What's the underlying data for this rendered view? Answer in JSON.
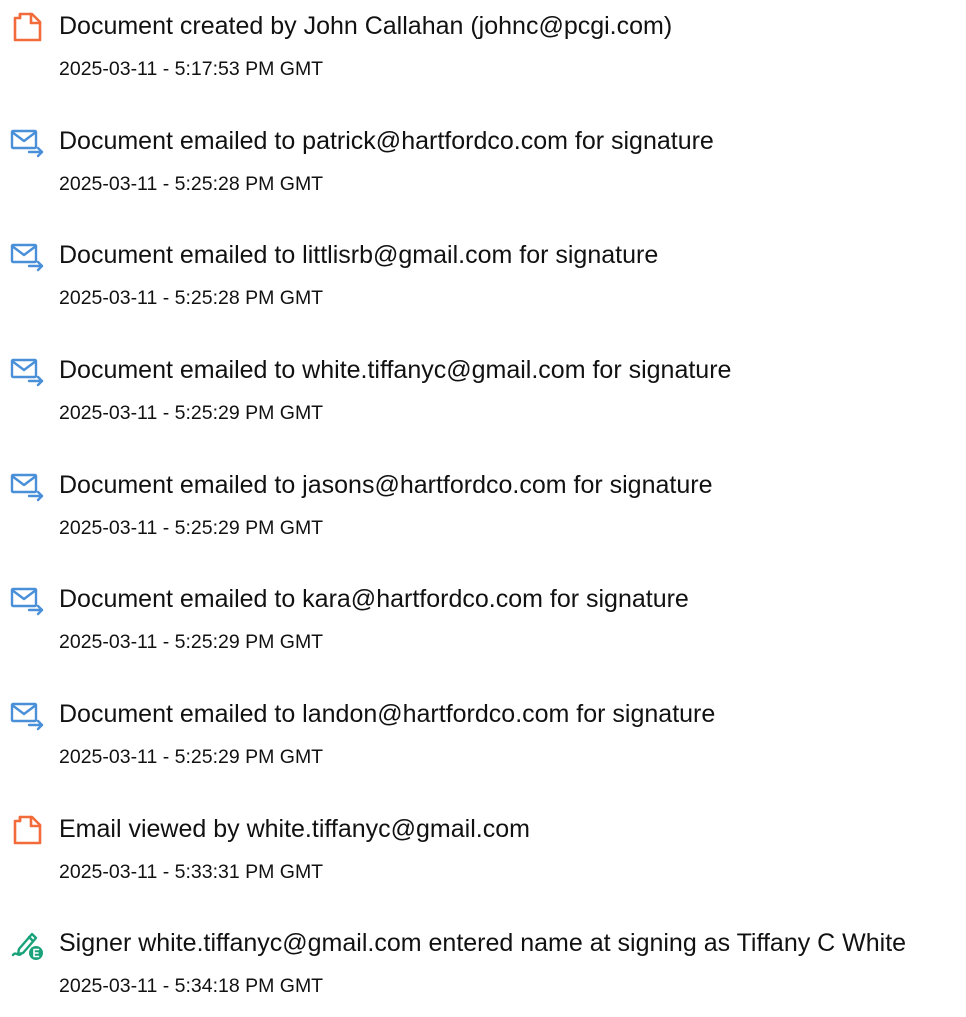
{
  "icon_colors": {
    "document": "#f26b3a",
    "email": "#4a90d9",
    "signature": "#1aa37a"
  },
  "events": [
    {
      "icon": "document-icon",
      "description": "Document created by John Callahan (johnc@pcgi.com)",
      "timestamp": "2025-03-11 - 5:17:53 PM GMT"
    },
    {
      "icon": "email-sent-icon",
      "description": "Document emailed to patrick@hartfordco.com for signature",
      "timestamp": "2025-03-11 - 5:25:28 PM GMT"
    },
    {
      "icon": "email-sent-icon",
      "description": "Document emailed to littlisrb@gmail.com for signature",
      "timestamp": "2025-03-11 - 5:25:28 PM GMT"
    },
    {
      "icon": "email-sent-icon",
      "description": "Document emailed to white.tiffanyc@gmail.com for signature",
      "timestamp": "2025-03-11 - 5:25:29 PM GMT"
    },
    {
      "icon": "email-sent-icon",
      "description": "Document emailed to jasons@hartfordco.com for signature",
      "timestamp": "2025-03-11 - 5:25:29 PM GMT"
    },
    {
      "icon": "email-sent-icon",
      "description": "Document emailed to kara@hartfordco.com for signature",
      "timestamp": "2025-03-11 - 5:25:29 PM GMT"
    },
    {
      "icon": "email-sent-icon",
      "description": "Document emailed to landon@hartfordco.com for signature",
      "timestamp": "2025-03-11 - 5:25:29 PM GMT"
    },
    {
      "icon": "document-icon",
      "description": "Email viewed by white.tiffanyc@gmail.com",
      "timestamp": "2025-03-11 - 5:33:31 PM GMT"
    },
    {
      "icon": "signature-icon",
      "description": "Signer white.tiffanyc@gmail.com entered name at signing as Tiffany C White",
      "timestamp": "2025-03-11 - 5:34:18 PM GMT"
    }
  ]
}
